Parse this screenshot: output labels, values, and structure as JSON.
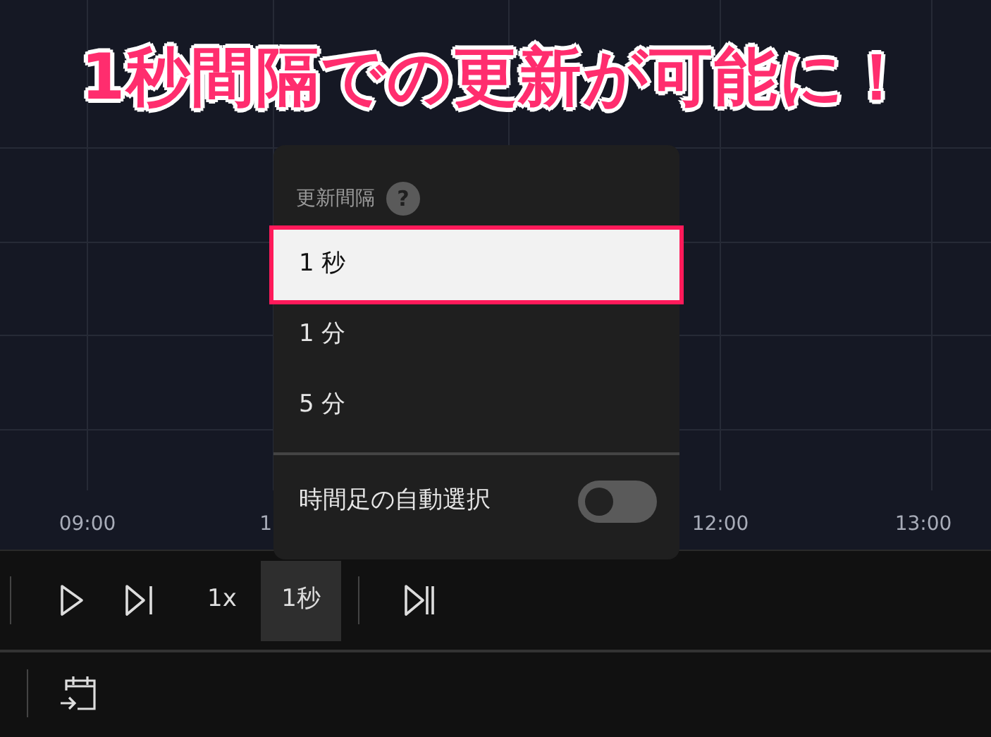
{
  "headline": "1秒間隔での更新が可能に！",
  "chart": {
    "time_labels": [
      "09:00",
      "1",
      "12:00",
      "13:00"
    ]
  },
  "menu": {
    "title": "更新間隔",
    "help": "?",
    "options": [
      {
        "label": "1 秒",
        "selected": true,
        "highlighted": true
      },
      {
        "label": "1 分",
        "selected": false,
        "highlighted": false
      },
      {
        "label": "5 分",
        "selected": false,
        "highlighted": false
      }
    ],
    "auto_select": {
      "label": "時間足の自動選択",
      "on": false
    }
  },
  "toolbar": [
    {
      "kind": "divider"
    },
    {
      "kind": "play"
    },
    {
      "kind": "step"
    },
    {
      "kind": "text",
      "label": "1x",
      "selected": false
    },
    {
      "kind": "text",
      "label": "1秒",
      "selected": true
    },
    {
      "kind": "divider"
    },
    {
      "kind": "skip"
    }
  ]
}
